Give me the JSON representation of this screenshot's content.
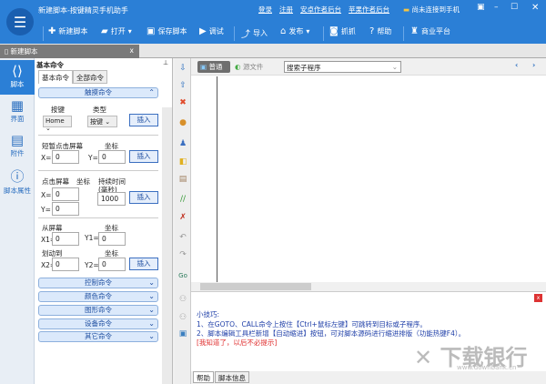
{
  "app": {
    "title": "新建脚本-按键精灵手机助手",
    "links": [
      "登录",
      "注册",
      "安卓作者后台",
      "苹果作者后台"
    ],
    "device_status": "尚未连接到手机"
  },
  "toolbar": [
    {
      "icon": "plus-icon",
      "label": "新建脚本"
    },
    {
      "icon": "folder-icon",
      "label": "打开"
    },
    {
      "icon": "save-icon",
      "label": "保存脚本"
    },
    {
      "icon": "play-icon",
      "label": "调试"
    },
    {
      "icon": "import-icon",
      "label": "导入"
    },
    {
      "icon": "publish-icon",
      "label": "发布"
    },
    {
      "icon": "camera-icon",
      "label": "抓抓"
    },
    {
      "icon": "help-icon",
      "label": "帮助"
    },
    {
      "icon": "moneybag-icon",
      "label": "商业平台"
    }
  ],
  "doc_tab": {
    "label": "新建脚本",
    "close": "x"
  },
  "sidebar": [
    {
      "label": "脚本",
      "icon": "script-icon"
    },
    {
      "label": "界面",
      "icon": "ui-icon"
    },
    {
      "label": "附件",
      "icon": "attachment-icon"
    },
    {
      "label": "脚本属性",
      "icon": "info-icon"
    }
  ],
  "panel": {
    "title": "基本命令",
    "tabs": [
      "基本命令",
      "全部命令"
    ],
    "touch_group": "触摸命令",
    "key_label": "按键",
    "type_label": "类型",
    "key_value": "Home",
    "type_value": "按键",
    "insert": "插入",
    "tap_label": "短暂点击屏幕",
    "coord": "坐标",
    "x": "X=",
    "y": "Y=",
    "zero": "0",
    "press_label": "点击屏幕",
    "duration_label": "持续时间",
    "duration_unit": "(毫秒)",
    "duration_value": "1000",
    "from_label": "从屏幕",
    "to_label": "划动到",
    "x1": "X1=",
    "y1": "Y1=",
    "x2": "X2=",
    "y2": "Y2=",
    "groups": [
      "控制命令",
      "颜色命令",
      "图形命令",
      "设备命令",
      "其它命令"
    ]
  },
  "editor": {
    "mode_normal": "普通",
    "mode_source": "源文件",
    "search_placeholder": "搜索子程序"
  },
  "tips": {
    "title": "小技巧:",
    "line1": "1、在GOTO、CALL命令上按住【Ctrl+鼠标左键】可跳转到目标或子程序。",
    "line2": "2、脚本编辑工具栏新增【自动缩进】按钮，可对脚本源码进行缩进排版（功能热键F4）。",
    "dismiss": "[我知道了，以后不必提示]"
  },
  "bottom_tabs": [
    "帮助",
    "脚本信息"
  ],
  "watermark": {
    "text": "下载银行",
    "url": "www.downbank.cn"
  },
  "colors": {
    "titlebar": "#2b7fd6",
    "accent": "#1f4fa0",
    "dismiss": "#e03030"
  }
}
